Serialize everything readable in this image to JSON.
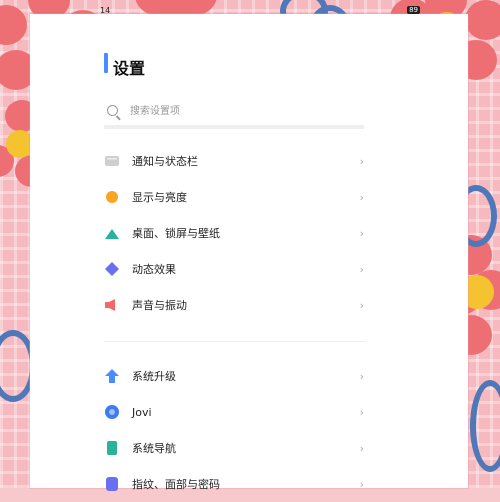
{
  "status": {
    "time": "14",
    "battery": "89"
  },
  "header": {
    "title": "设置"
  },
  "search": {
    "placeholder": "搜索设置项"
  },
  "groups": [
    {
      "items": [
        {
          "label": "通知与状态栏",
          "icon": "notification-icon"
        },
        {
          "label": "显示与亮度",
          "icon": "display-icon"
        },
        {
          "label": "桌面、锁屏与壁纸",
          "icon": "wallpaper-icon"
        },
        {
          "label": "动态效果",
          "icon": "animation-icon"
        },
        {
          "label": "声音与振动",
          "icon": "sound-icon"
        }
      ]
    },
    {
      "items": [
        {
          "label": "系统升级",
          "icon": "upgrade-icon"
        },
        {
          "label": "Jovi",
          "icon": "jovi-icon"
        },
        {
          "label": "系统导航",
          "icon": "navigation-icon"
        },
        {
          "label": "指纹、面部与密码",
          "icon": "fingerprint-icon"
        }
      ]
    }
  ],
  "chevron": "›",
  "colors": {
    "accent": "#4a8cff",
    "petal": "#ee6f73",
    "flower_center": "#f5c230",
    "squiggle": "#5077b8"
  }
}
